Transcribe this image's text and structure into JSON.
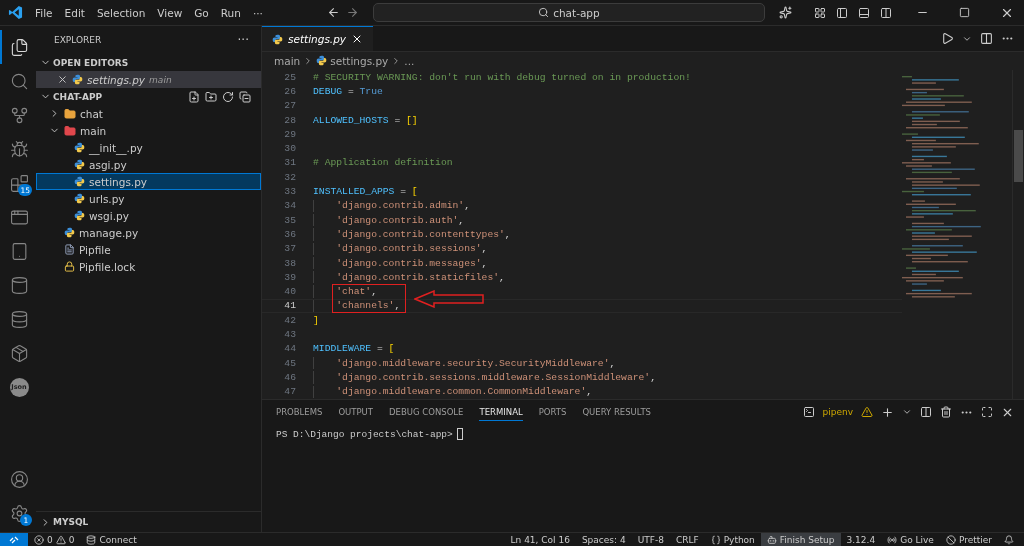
{
  "title_bar": {
    "menu": [
      "File",
      "Edit",
      "Selection",
      "View",
      "Go",
      "Run",
      "···"
    ],
    "search": "chat-app"
  },
  "activity_bar": {
    "items": [
      {
        "kind": "files",
        "selected": true
      },
      {
        "kind": "search",
        "selected": false
      },
      {
        "kind": "source-control",
        "selected": false
      },
      {
        "kind": "run",
        "selected": false
      },
      {
        "kind": "extensions",
        "selected": false,
        "badge": "15"
      },
      {
        "kind": "remote",
        "selected": false
      },
      {
        "kind": "book",
        "selected": false
      },
      {
        "kind": "cylinder",
        "selected": false
      },
      {
        "kind": "database",
        "selected": false
      },
      {
        "kind": "package",
        "selected": false
      },
      {
        "kind": "json",
        "selected": false,
        "label": "Json"
      }
    ],
    "bottom": [
      {
        "kind": "account"
      },
      {
        "kind": "settings",
        "badge": "1"
      }
    ]
  },
  "explorer": {
    "title": "EXPLORER",
    "more": "···",
    "open_editors": {
      "title": "OPEN EDITORS",
      "expanded": true,
      "items": [
        {
          "name": "settings.py",
          "description": "main",
          "kind": "python"
        }
      ]
    },
    "project": {
      "title": "CHAT-APP",
      "expanded": true,
      "items": [
        {
          "name": "chat",
          "kind": "folder",
          "color": "#e8a33d",
          "expanded": false,
          "selected": false
        },
        {
          "name": "main",
          "kind": "folder",
          "color": "#e0474c",
          "expanded": true,
          "selected": false,
          "children": [
            {
              "name": "__init__.py",
              "kind": "python",
              "selected": false
            },
            {
              "name": "asgi.py",
              "kind": "python",
              "selected": false
            },
            {
              "name": "settings.py",
              "kind": "python",
              "selected": true
            },
            {
              "name": "urls.py",
              "kind": "python",
              "selected": false
            },
            {
              "name": "wsgi.py",
              "kind": "python",
              "selected": false
            }
          ]
        },
        {
          "name": "manage.py",
          "kind": "python",
          "selected": false
        },
        {
          "name": "Pipfile",
          "kind": "pipfile",
          "selected": false
        },
        {
          "name": "Pipfile.lock",
          "kind": "lock",
          "selected": false
        }
      ]
    },
    "collapsed_sections": [
      {
        "title": "MYSQL",
        "expanded": false
      }
    ]
  },
  "editor": {
    "tabs": [
      {
        "label": "settings.py",
        "kind": "python",
        "selected": true
      }
    ],
    "breadcrumbs": [
      "main",
      "settings.py",
      "..."
    ],
    "lines": [
      {
        "number": "25",
        "current": false,
        "indented": false,
        "highlighted": false,
        "tokens": [
          {
            "kind": "comment",
            "text": "# SECURITY WARNING: don't run with debug turned on in production!"
          }
        ]
      },
      {
        "number": "26",
        "current": false,
        "indented": false,
        "highlighted": false,
        "tokens": [
          {
            "kind": "variable",
            "text": "DEBUG"
          },
          {
            "kind": "op",
            "text": " = "
          },
          {
            "kind": "constant",
            "text": "True"
          }
        ]
      },
      {
        "number": "27",
        "current": false,
        "indented": false,
        "highlighted": false
      },
      {
        "number": "28",
        "current": false,
        "indented": false,
        "highlighted": false,
        "tokens": [
          {
            "kind": "variable",
            "text": "ALLOWED_HOSTS"
          },
          {
            "kind": "op",
            "text": " = "
          },
          {
            "kind": "bracket",
            "text": "[]"
          }
        ]
      },
      {
        "number": "29",
        "current": false,
        "indented": false,
        "highlighted": false
      },
      {
        "number": "30",
        "current": false,
        "indented": false,
        "highlighted": false
      },
      {
        "number": "31",
        "current": false,
        "indented": false,
        "highlighted": false,
        "tokens": [
          {
            "kind": "comment",
            "text": "# Application definition"
          }
        ]
      },
      {
        "number": "32",
        "current": false,
        "indented": false,
        "highlighted": false
      },
      {
        "number": "33",
        "current": false,
        "indented": false,
        "highlighted": false,
        "tokens": [
          {
            "kind": "variable",
            "text": "INSTALLED_APPS"
          },
          {
            "kind": "op",
            "text": " = "
          },
          {
            "kind": "bracket",
            "text": "["
          }
        ]
      },
      {
        "number": "34",
        "current": false,
        "indented": true,
        "highlighted": false,
        "tokens": [
          {
            "kind": "string",
            "text": "'django.contrib.admin'"
          },
          {
            "kind": "op",
            "text": ","
          }
        ]
      },
      {
        "number": "35",
        "current": false,
        "indented": true,
        "highlighted": false,
        "tokens": [
          {
            "kind": "string",
            "text": "'django.contrib.auth'"
          },
          {
            "kind": "op",
            "text": ","
          }
        ]
      },
      {
        "number": "36",
        "current": false,
        "indented": true,
        "highlighted": false,
        "tokens": [
          {
            "kind": "string",
            "text": "'django.contrib.contenttypes'"
          },
          {
            "kind": "op",
            "text": ","
          }
        ]
      },
      {
        "number": "37",
        "current": false,
        "indented": true,
        "highlighted": false,
        "tokens": [
          {
            "kind": "string",
            "text": "'django.contrib.sessions'"
          },
          {
            "kind": "op",
            "text": ","
          }
        ]
      },
      {
        "number": "38",
        "current": false,
        "indented": true,
        "highlighted": false,
        "tokens": [
          {
            "kind": "string",
            "text": "'django.contrib.messages'"
          },
          {
            "kind": "op",
            "text": ","
          }
        ]
      },
      {
        "number": "39",
        "current": false,
        "indented": true,
        "highlighted": false,
        "tokens": [
          {
            "kind": "string",
            "text": "'django.contrib.staticfiles'"
          },
          {
            "kind": "op",
            "text": ","
          }
        ]
      },
      {
        "number": "40",
        "current": false,
        "indented": true,
        "highlighted": true,
        "tokens": [
          {
            "kind": "string",
            "text": "'chat'"
          },
          {
            "kind": "op",
            "text": ","
          }
        ]
      },
      {
        "number": "41",
        "current": true,
        "indented": true,
        "highlighted": true,
        "tokens": [
          {
            "kind": "string",
            "text": "'channels'"
          },
          {
            "kind": "op",
            "text": ","
          }
        ]
      },
      {
        "number": "42",
        "current": false,
        "indented": false,
        "highlighted": false,
        "tokens": [
          {
            "kind": "bracket",
            "text": "]"
          }
        ]
      },
      {
        "number": "43",
        "current": false,
        "indented": false,
        "highlighted": false
      },
      {
        "number": "44",
        "current": false,
        "indented": false,
        "highlighted": false,
        "tokens": [
          {
            "kind": "variable",
            "text": "MIDDLEWARE"
          },
          {
            "kind": "op",
            "text": " = "
          },
          {
            "kind": "bracket",
            "text": "["
          }
        ]
      },
      {
        "number": "45",
        "current": false,
        "indented": true,
        "highlighted": false,
        "tokens": [
          {
            "kind": "string",
            "text": "'django.middleware.security.SecurityMiddleware'"
          },
          {
            "kind": "op",
            "text": ","
          }
        ]
      },
      {
        "number": "46",
        "current": false,
        "indented": true,
        "highlighted": false,
        "tokens": [
          {
            "kind": "string",
            "text": "'django.contrib.sessions.middleware.SessionMiddleware'"
          },
          {
            "kind": "op",
            "text": ","
          }
        ]
      },
      {
        "number": "47",
        "current": false,
        "indented": true,
        "highlighted": false,
        "tokens": [
          {
            "kind": "string",
            "text": "'django.middleware.common.CommonMiddleware'"
          },
          {
            "kind": "op",
            "text": ","
          }
        ]
      }
    ]
  },
  "panel": {
    "tabs": [
      {
        "label": "PROBLEMS",
        "selected": false
      },
      {
        "label": "OUTPUT",
        "selected": false
      },
      {
        "label": "DEBUG CONSOLE",
        "selected": false
      },
      {
        "label": "TERMINAL",
        "selected": true
      },
      {
        "label": "PORTS",
        "selected": false
      },
      {
        "label": "QUERY RESULTS",
        "selected": false
      }
    ],
    "terminal_name": "pipenv",
    "terminal_lines": [
      "PS D:\\Django projects\\chat-app>"
    ]
  },
  "status_bar": {
    "errors": "0",
    "warnings": "0",
    "left": [
      {
        "kind": "connect",
        "text": "Connect"
      }
    ],
    "right": [
      {
        "kind": "plain",
        "text": "Ln 41, Col 16"
      },
      {
        "kind": "plain",
        "text": "Spaces: 4"
      },
      {
        "kind": "plain",
        "text": "UTF-8"
      },
      {
        "kind": "plain",
        "text": "CRLF"
      },
      {
        "kind": "language",
        "text": "Python"
      },
      {
        "kind": "setup",
        "text": "Finish Setup"
      },
      {
        "kind": "plain",
        "text": "3.12.4"
      },
      {
        "kind": "live",
        "text": "Go Live"
      },
      {
        "kind": "prettier",
        "text": "Prettier"
      },
      {
        "kind": "bell"
      }
    ]
  }
}
